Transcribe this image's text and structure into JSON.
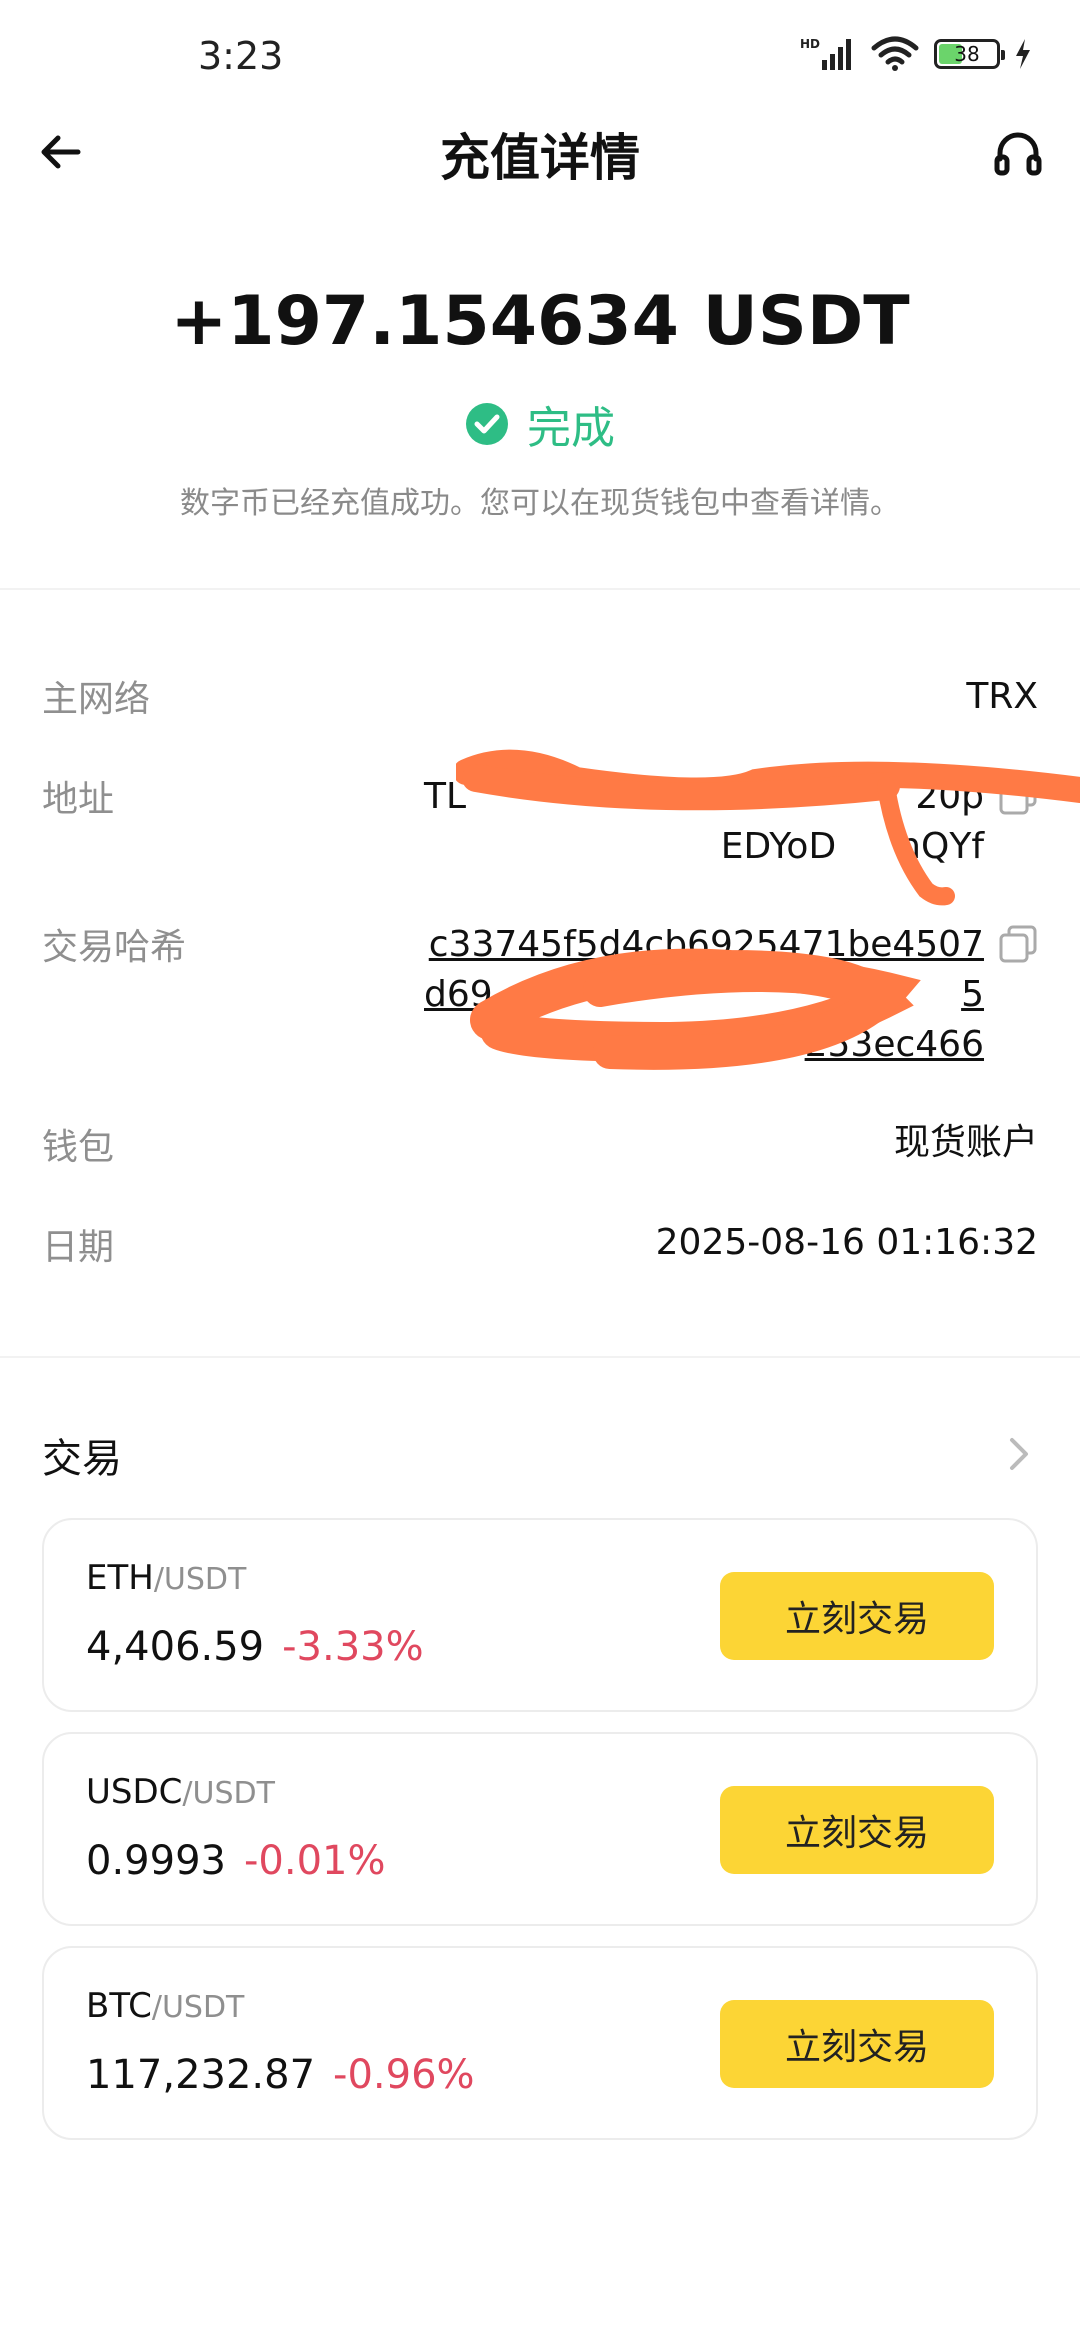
{
  "status_bar": {
    "time": "3:23",
    "battery": "38",
    "battery_level": 0.38,
    "icons": [
      "hd-signal-icon",
      "wifi-icon",
      "battery-icon",
      "charging-icon"
    ]
  },
  "header": {
    "title": "充值详情",
    "back_icon": "back-arrow-icon",
    "support_icon": "headset-icon"
  },
  "summary": {
    "amount": "+197.154634 USDT",
    "status": "完成",
    "status_color": "#2ebd85",
    "description": "数字币已经充值成功。您可以在现货钱包中查看详情。"
  },
  "details": {
    "network_label": "主网络",
    "network_value": "TRX",
    "address_label": "地址",
    "address_line1": "TL",
    "address_line1_end": "20p",
    "address_line2": "EDYoD",
    "address_line2_end": "nQYf",
    "hash_label": "交易哈希",
    "hash_line1": "c33745f5d4cb6925471be4507",
    "hash_line2": "d69",
    "hash_line2_end": "5",
    "hash_line3_end": "253ec466",
    "wallet_label": "钱包",
    "wallet_value": "现货账户",
    "date_label": "日期",
    "date_value": "2025-08-16 01:16:32"
  },
  "trade": {
    "title": "交易",
    "button_label": "立刻交易",
    "accent": "#fcd535",
    "negative_color": "#e0485f",
    "pairs": [
      {
        "base": "ETH",
        "quote": "/USDT",
        "price": "4,406.59",
        "change": "-3.33%"
      },
      {
        "base": "USDC",
        "quote": "/USDT",
        "price": "0.9993",
        "change": "-0.01%"
      },
      {
        "base": "BTC",
        "quote": "/USDT",
        "price": "117,232.87",
        "change": "-0.96%"
      }
    ]
  }
}
